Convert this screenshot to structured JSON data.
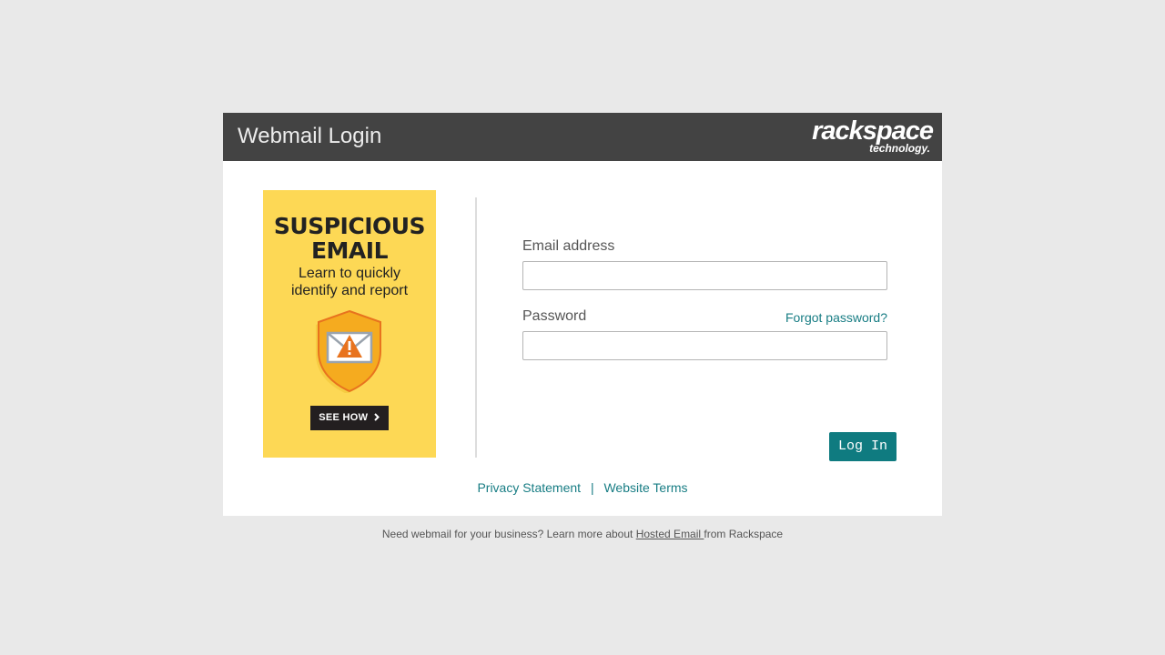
{
  "header": {
    "title": "Webmail Login",
    "logo_main": "rackspace",
    "logo_sub": "technology."
  },
  "promo": {
    "title_line1": "SUSPICIOUS",
    "title_line2": "EMAIL",
    "subtitle_line1": "Learn to quickly",
    "subtitle_line2": "identify and report",
    "button": "SEE HOW",
    "button_icon": "chevron-right-icon",
    "icon": "shield-warning-envelope-icon",
    "colors": {
      "background": "#fdd855",
      "shield": "#f5ab1f",
      "warning": "#e8731e"
    }
  },
  "form": {
    "email_label": "Email address",
    "email_value": "",
    "password_label": "Password",
    "password_value": "",
    "forgot_password": "Forgot password?",
    "login_button": "Log In"
  },
  "links": {
    "privacy": "Privacy Statement",
    "separator": "|",
    "terms": "Website Terms"
  },
  "footer": {
    "text_before": "Need webmail for your business? Learn more about ",
    "link": "Hosted Email ",
    "text_after": "from Rackspace"
  },
  "colors": {
    "page_background": "#e9e9e9",
    "header_background": "#434343",
    "accent": "#0f7b80",
    "link": "#187d84"
  }
}
